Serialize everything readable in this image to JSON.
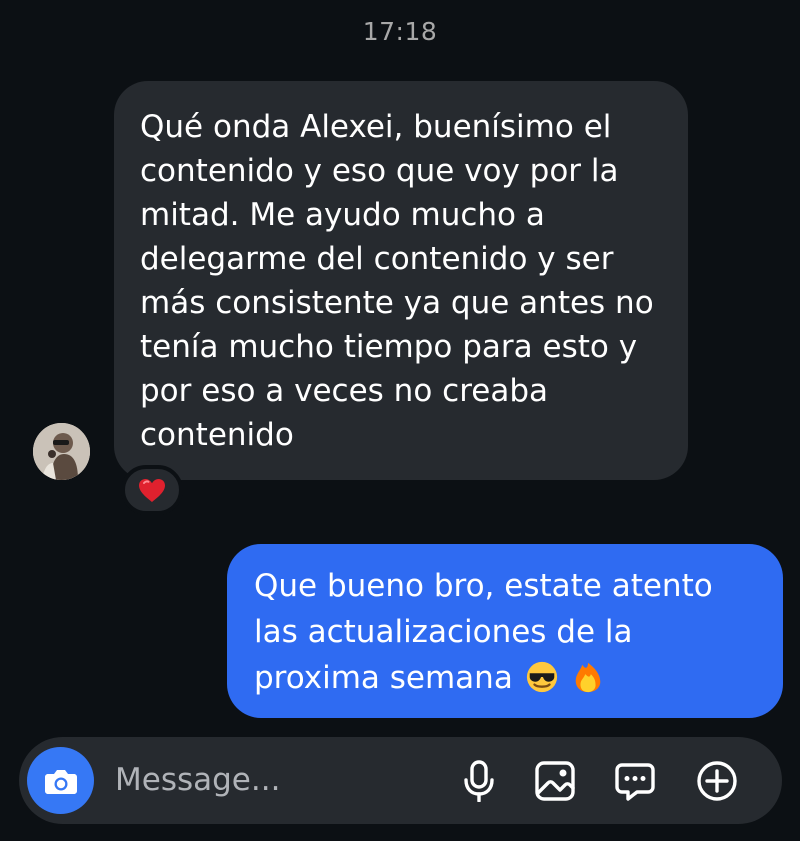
{
  "chat": {
    "time": "17:18",
    "incoming": {
      "text": "Qué onda Alexei, buenísimo el contenido y eso que voy por la mitad. Me ayudo mucho a delegarme del contenido y ser más consistente ya que antes no tenía mucho tiempo para esto y por eso a veces no creaba contenido",
      "reaction": "heart-icon"
    },
    "outgoing": {
      "text": "Que bueno bro, estate atento las actualizaciones de la proxima semana",
      "emojis": [
        "smiling-face-with-sunglasses",
        "fire"
      ]
    }
  },
  "composer": {
    "placeholder": "Message...",
    "icons": [
      "camera-icon",
      "microphone-icon",
      "gallery-icon",
      "sticker-chat-icon",
      "plus-icon"
    ]
  },
  "colors": {
    "background": "#0c1014",
    "incoming_bubble": "#262a2f",
    "outgoing_bubble": "#2f6bf2",
    "camera_button": "#3678f5",
    "heart": "#e0212e"
  }
}
